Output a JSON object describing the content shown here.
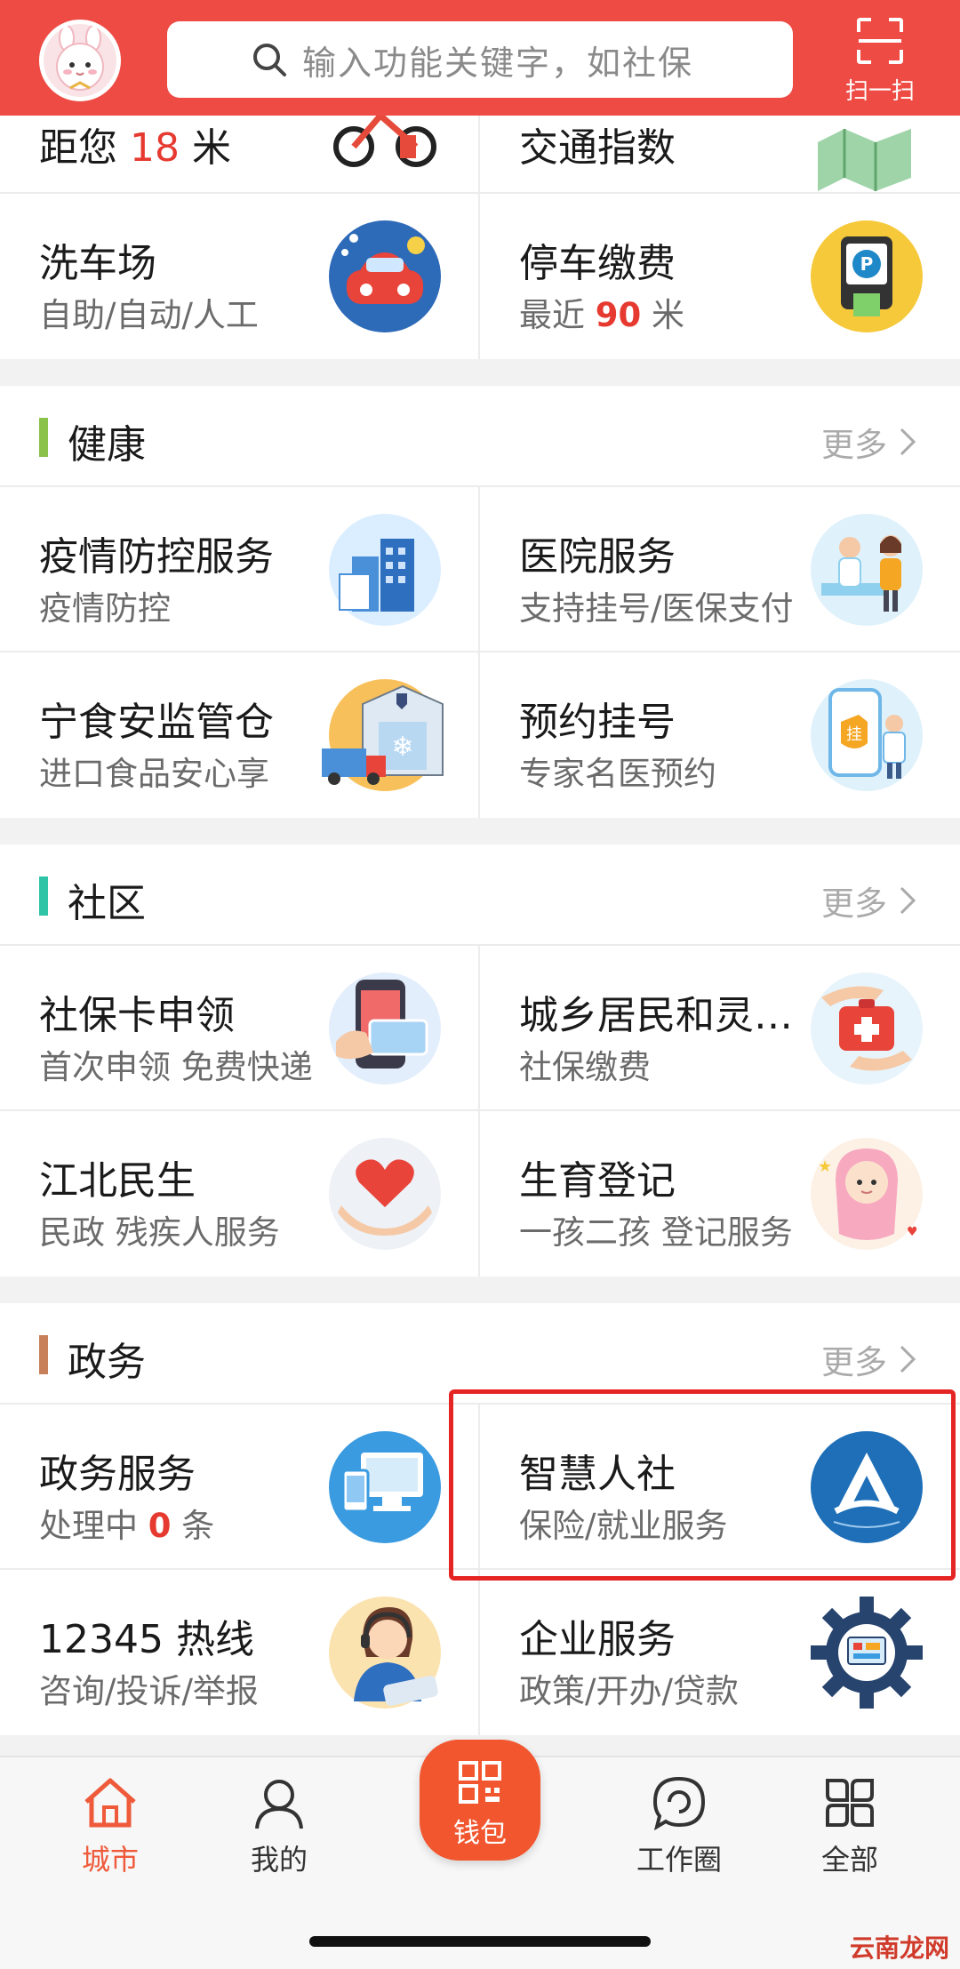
{
  "header": {
    "search_placeholder": "输入功能关键字，如社保",
    "scan_label": "扫一扫"
  },
  "top_row": [
    {
      "title_pre": "距您 ",
      "title_hl": "18",
      "title_post": " 米"
    },
    {
      "title": "交通指数"
    }
  ],
  "row_carwash": [
    {
      "title": "洗车场",
      "sub": "自助/自动/人工",
      "icon": "car-wash-icon"
    },
    {
      "title": "停车缴费",
      "sub_pre": "最近 ",
      "sub_hl": "90",
      "sub_post": " 米",
      "icon": "parking-icon"
    }
  ],
  "sections": [
    {
      "title": "健康",
      "more": "更多",
      "bar_color": "#8bc34a",
      "rows": [
        [
          {
            "title": "疫情防控服务",
            "sub": "疫情防控",
            "icon": "city-building-icon"
          },
          {
            "title": "医院服务",
            "sub": "支持挂号/医保支付",
            "icon": "doctor-patient-icon"
          }
        ],
        [
          {
            "title": "宁食安监管仓",
            "sub": "进口食品安心享",
            "icon": "cold-storage-icon"
          },
          {
            "title": "预约挂号",
            "sub": "专家名医预约",
            "icon": "phone-doctor-icon"
          }
        ]
      ]
    },
    {
      "title": "社区",
      "more": "更多",
      "bar_color": "#2ec4a5",
      "rows": [
        [
          {
            "title": "社保卡申领",
            "sub": "首次申领 免费快递",
            "icon": "social-card-icon"
          },
          {
            "title": "城乡居民和灵…",
            "sub": "社保缴费",
            "icon": "first-aid-icon"
          }
        ],
        [
          {
            "title": "江北民生",
            "sub": "民政  残疾人服务",
            "icon": "heart-hands-icon"
          },
          {
            "title": "生育登记",
            "sub": "一孩二孩 登记服务",
            "icon": "baby-icon"
          }
        ]
      ]
    },
    {
      "title": "政务",
      "more": "更多",
      "bar_color": "#c8805a",
      "rows": [
        [
          {
            "title": "政务服务",
            "sub_pre": "处理中 ",
            "sub_hl": "0",
            "sub_post": " 条",
            "icon": "computer-icon"
          },
          {
            "title": "智慧人社",
            "sub": "保险/就业服务",
            "icon": "hrss-logo-icon"
          }
        ],
        [
          {
            "title": "12345 热线",
            "sub": "咨询/投诉/举报",
            "icon": "headset-agent-icon"
          },
          {
            "title": "企业服务",
            "sub": "政策/开办/贷款",
            "icon": "gear-screen-icon"
          }
        ]
      ]
    }
  ],
  "tabbar": {
    "city": "城市",
    "mine": "我的",
    "wallet": "钱包",
    "circle": "工作圈",
    "all": "全部"
  },
  "watermark": "云南龙网",
  "colors": {
    "brand": "#ee4b44",
    "highlight": "#e63a30",
    "active_tab": "#ee5a3a"
  }
}
